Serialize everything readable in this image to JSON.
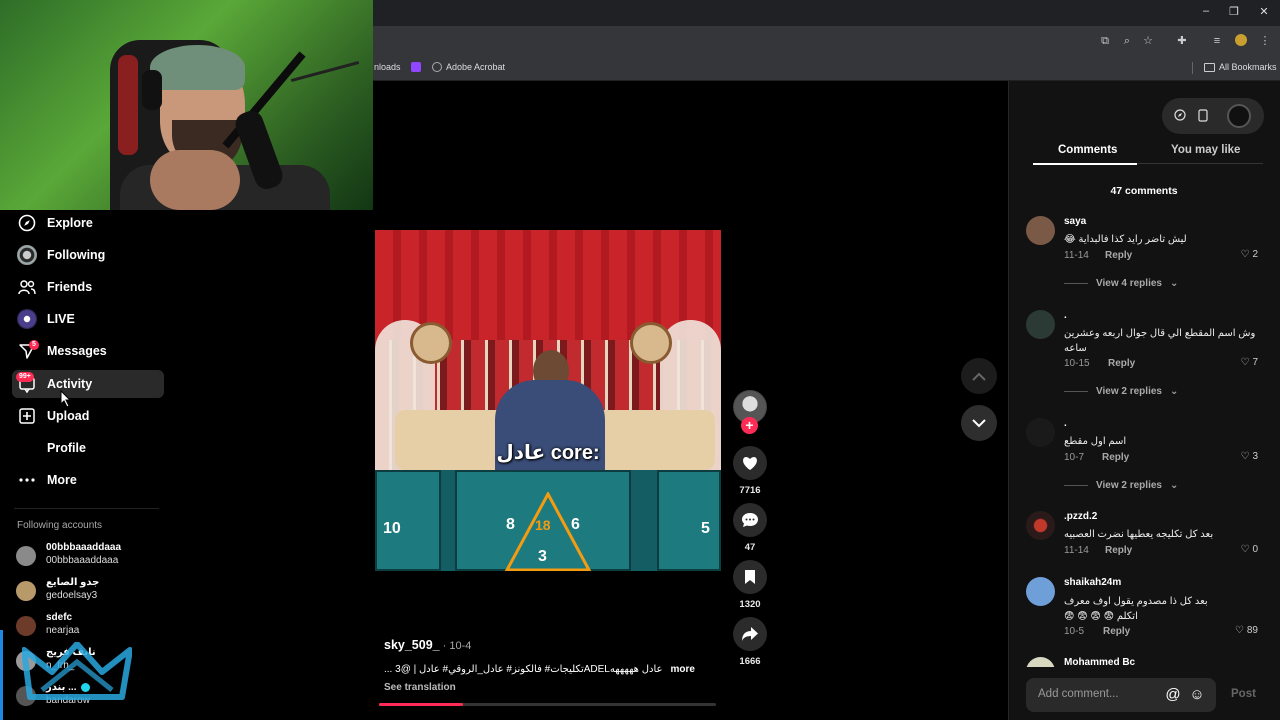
{
  "browser": {
    "bookmarks": [
      "nloads",
      "Adobe Acrobat"
    ],
    "all_bookmarks": "All Bookmarks",
    "window_controls": [
      "–",
      "❐",
      "✕"
    ]
  },
  "nav": {
    "items": [
      {
        "label": "Explore",
        "icon": "compass-icon"
      },
      {
        "label": "Following",
        "icon": "following-avatar-icon"
      },
      {
        "label": "Friends",
        "icon": "friends-icon"
      },
      {
        "label": "LIVE",
        "icon": "live-avatar-icon"
      },
      {
        "label": "Messages",
        "icon": "messages-icon",
        "badge": "5"
      },
      {
        "label": "Activity",
        "icon": "activity-icon",
        "badge": "99+"
      },
      {
        "label": "Upload",
        "icon": "upload-icon"
      },
      {
        "label": "Profile",
        "icon": ""
      },
      {
        "label": "More",
        "icon": "more-icon"
      }
    ],
    "following_title": "Following accounts",
    "accounts": [
      {
        "name": "00bbbaaaddaaa",
        "handle": "00bbbaaaddaaa"
      },
      {
        "name": "جدو الصايع",
        "handle": "gedoelsay3"
      },
      {
        "name": "sdefc",
        "handle": "nearjaa"
      },
      {
        "name": "نايف فريج",
        "handle": "n_frh_"
      },
      {
        "name": "بندر ...",
        "handle": "bandarow"
      }
    ]
  },
  "video": {
    "caption_overlay": "عادل core:",
    "board_numbers": [
      "10",
      "8",
      "18",
      "6",
      "3",
      "5"
    ],
    "author": "sky_509_",
    "date": "10-4",
    "description": "... تكليجات# فالكونز# عادل_الروقي# عادل | @3ADELعادل هههههه",
    "more": "more",
    "see_translation": "See translation",
    "progress": 0.25
  },
  "actions": {
    "likes": "7716",
    "comments": "47",
    "saves": "1320",
    "shares": "1666"
  },
  "panel": {
    "tabs": [
      "Comments",
      "You may like"
    ],
    "comment_count": "47 comments",
    "comments": [
      {
        "user": "saya",
        "text": "ليش تاضر رايد كذا فالبداية 😂",
        "date": "11-14",
        "reply": "Reply",
        "likes": "2",
        "view_replies": "View 4 replies"
      },
      {
        "user": ".",
        "text": "وش اسم المقطع الي قال جوال اربعه وعشرين ساعه",
        "date": "10-15",
        "reply": "Reply",
        "likes": "7",
        "view_replies": "View 2 replies"
      },
      {
        "user": ".",
        "text": "اسم اول مقطع",
        "date": "10-7",
        "reply": "Reply",
        "likes": "3",
        "view_replies": "View 2 replies"
      },
      {
        "user": ".pzzd.2",
        "text": "بعد كل تكليجه يعطيها نضرت العصبيه",
        "date": "11-14",
        "reply": "Reply",
        "likes": "0",
        "view_replies": ""
      },
      {
        "user": "shaikah24m",
        "text": "بعد كل ذا مصدوم يقول اوف معرف اتكلم 😨 😨 😨 😨",
        "date": "10-5",
        "reply": "Reply",
        "likes": "89",
        "view_replies": ""
      },
      {
        "user": "Mohammed Bc",
        "text": "",
        "date": "",
        "reply": "",
        "likes": "",
        "view_replies": ""
      }
    ],
    "add_comment_placeholder": "Add comment...",
    "post": "Post"
  },
  "colors": {
    "accent": "#fe2c55",
    "panel_bg": "#121212",
    "verified": "#20d5ec"
  }
}
